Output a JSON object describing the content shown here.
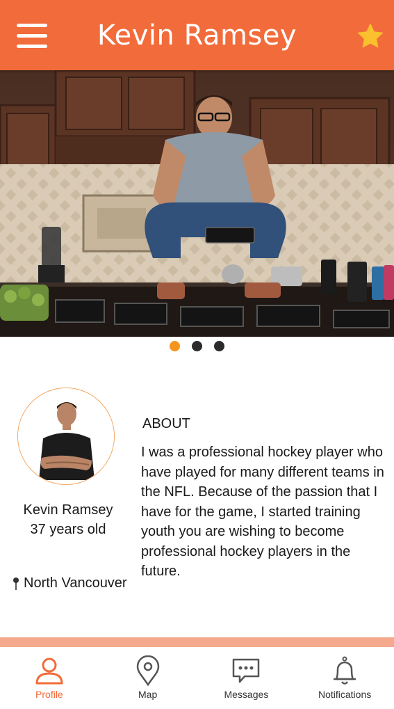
{
  "header": {
    "title": "Kevin Ramsey",
    "menu_icon": "hamburger-menu-icon",
    "favorite_icon": "star-icon",
    "accent_color": "#f26b3a",
    "star_color": "#fbc02d"
  },
  "gallery": {
    "image_alt": "Man crouching on kitchen counter holding meal prep container",
    "page_count": 3,
    "active_page": 1
  },
  "profile": {
    "name": "Kevin Ramsey",
    "age_text": "37 years old",
    "location": "North Vancouver",
    "location_icon": "location-pin-icon"
  },
  "about": {
    "heading": "ABOUT",
    "text": "I was a professional hockey player who have played for many different teams in the NFL. Because of the passion that I have for the game, I started training youth you are wishing to become professional hockey players in the future."
  },
  "tabs": [
    {
      "label": "Profile",
      "icon": "person-icon",
      "active": true
    },
    {
      "label": "Map",
      "icon": "map-pin-icon",
      "active": false
    },
    {
      "label": "Messages",
      "icon": "chat-bubble-icon",
      "active": false
    },
    {
      "label": "Notifications",
      "icon": "bell-icon",
      "active": false
    }
  ]
}
